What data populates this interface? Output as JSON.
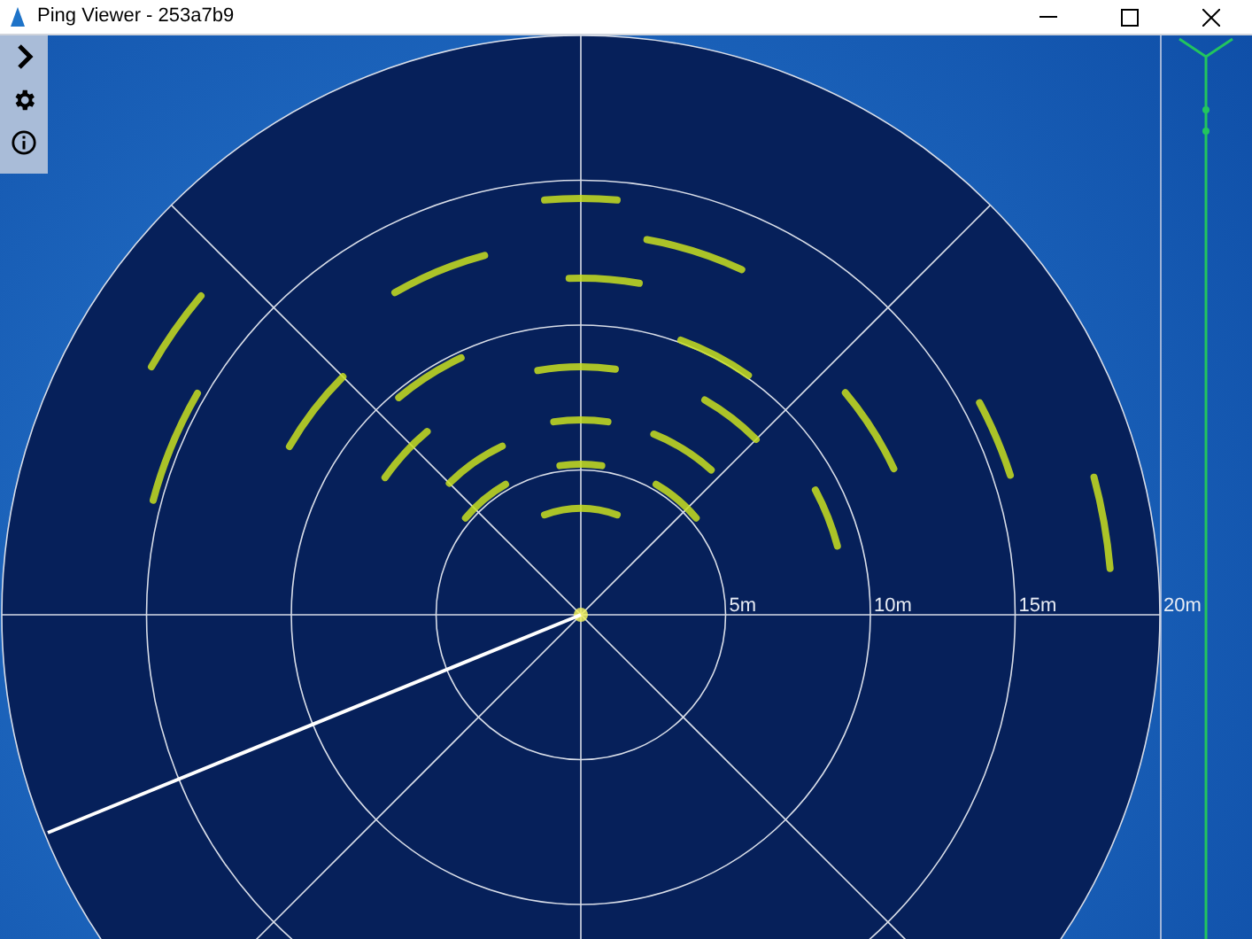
{
  "window": {
    "title": "Ping Viewer - 253a7b9"
  },
  "plot": {
    "range_labels": [
      "5m",
      "10m",
      "15m",
      "20m"
    ]
  }
}
